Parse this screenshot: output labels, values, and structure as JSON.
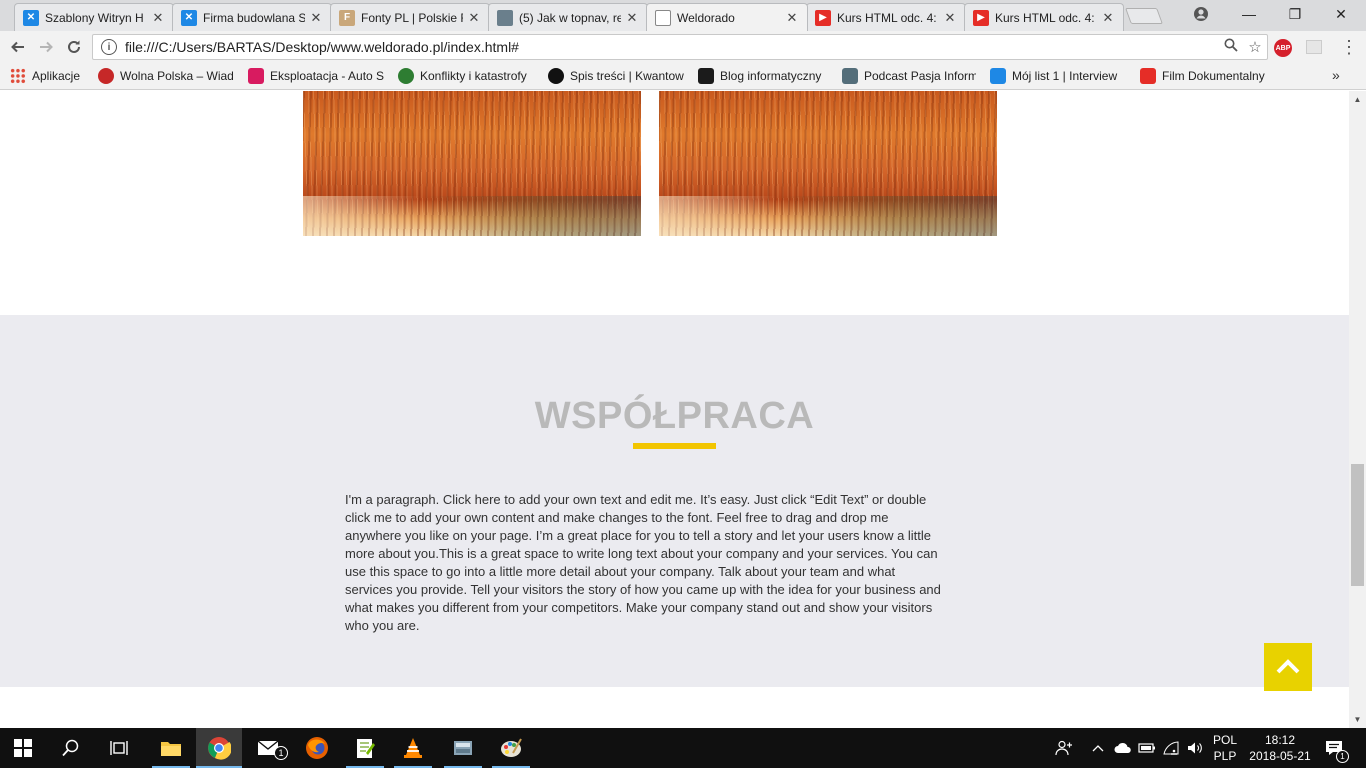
{
  "browser": {
    "tabs": [
      {
        "title": "Szablony Witryn H",
        "icon": "fav-x"
      },
      {
        "title": "Firma budowlana S",
        "icon": "fav-x"
      },
      {
        "title": "Fonty PL | Polskie F",
        "icon": "fav-f"
      },
      {
        "title": "(5) Jak w topnav, re",
        "icon": "fav-g"
      },
      {
        "title": "Weldorado",
        "icon": "fav-doc",
        "active": true
      },
      {
        "title": "Kurs HTML odc. 4:",
        "icon": "fav-yt"
      },
      {
        "title": "Kurs HTML odc. 4:",
        "icon": "fav-yt"
      }
    ],
    "tab_close_glyph": "✕",
    "window_controls": {
      "minimize": "—",
      "restore": "❐",
      "close": "✕"
    },
    "address": "file:///C:/Users/BARTAS/Desktop/www.weldorado.pl/index.html#",
    "info_glyph": "i",
    "abp_label": "ABP",
    "bookmarks": [
      {
        "label": "Aplikacje",
        "color": "#e04b3a"
      },
      {
        "label": "Wolna Polska – Wiad",
        "color": "#c62828"
      },
      {
        "label": "Eksploatacja - Auto S",
        "color": "#d81b60"
      },
      {
        "label": "Konflikty i katastrofy",
        "color": "#2e7d32"
      },
      {
        "label": "Spis treści | Kwantow",
        "color": "#111111"
      },
      {
        "label": "Blog informatyczny",
        "color": "#1b1b1b"
      },
      {
        "label": "Podcast Pasja Inform",
        "color": "#546e7a"
      },
      {
        "label": "Mój list 1 | Interview",
        "color": "#1e88e5"
      },
      {
        "label": "Film Dokumentalny",
        "color": "#e52d27"
      }
    ],
    "bookmarks_more": "»"
  },
  "page": {
    "section": {
      "title": "WSPÓŁPRACA",
      "accent_color": "#f2c500",
      "paragraph": "I'm a paragraph. Click here to add your own text and edit me. It’s easy. Just click “Edit Text” or double click me to add your own content and make changes to the font. Feel free to drag and drop me anywhere you like on your page. I’m a great place for you to tell a story and let your users know a little more about you.This is a great space to write long text about your company and your services. You can use this space to go into a little more detail about your company. Talk about your team and what services you provide. Tell your visitors the story of how you came up with the idea for your business and what makes you different from your competitors. Make your company stand out and show your visitors who you are."
    },
    "scroll_top_color": "#e8d200"
  },
  "taskbar": {
    "apps": [
      "start",
      "search",
      "task-view",
      "file-explorer",
      "chrome",
      "mail",
      "firefox",
      "notepad-plus-plus",
      "vlc",
      "scanner",
      "paint"
    ],
    "mail_badge": "1",
    "language": "POL",
    "layout": "PLP",
    "time": "18:12",
    "date": "2018-05-21",
    "notification_badge": "1"
  }
}
